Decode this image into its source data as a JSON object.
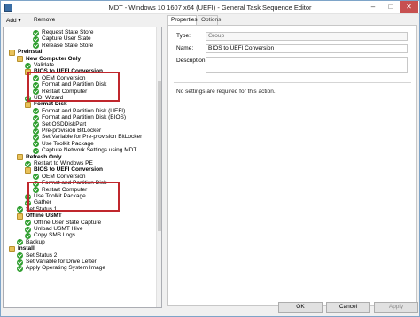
{
  "window": {
    "title": "MDT - Windows 10 1607 x64 (UEFI) - General Task Sequence Editor",
    "controls": {
      "minimize": "–",
      "maximize": "□",
      "close": "✕"
    }
  },
  "toolbar": {
    "add_label": "Add",
    "remove_label": "Remove"
  },
  "tree": [
    {
      "label": "Request State Store",
      "icon": "check",
      "indent": 3,
      "bold": false
    },
    {
      "label": "Capture User State",
      "icon": "check",
      "indent": 3,
      "bold": false
    },
    {
      "label": "Release State Store",
      "icon": "check",
      "indent": 3,
      "bold": false
    },
    {
      "label": "Preinstall",
      "icon": "folder",
      "indent": 0,
      "bold": true
    },
    {
      "label": "New Computer Only",
      "icon": "folder",
      "indent": 1,
      "bold": true
    },
    {
      "label": "Validate",
      "icon": "check",
      "indent": 2,
      "bold": false
    },
    {
      "label": "BIOS to UEFI Conversion",
      "icon": "folder",
      "indent": 2,
      "bold": true
    },
    {
      "label": "OEM Conversion",
      "icon": "check",
      "indent": 3,
      "bold": false
    },
    {
      "label": "Format and Partition Disk",
      "icon": "check",
      "indent": 3,
      "bold": false
    },
    {
      "label": "Restart Computer",
      "icon": "check",
      "indent": 3,
      "bold": false
    },
    {
      "label": "UDI Wizard",
      "icon": "check",
      "indent": 2,
      "bold": false
    },
    {
      "label": "Format Disk",
      "icon": "folder",
      "indent": 2,
      "bold": true
    },
    {
      "label": "Format and Partition Disk (UEFI)",
      "icon": "check",
      "indent": 3,
      "bold": false
    },
    {
      "label": "Format and Partition Disk (BIOS)",
      "icon": "check",
      "indent": 3,
      "bold": false
    },
    {
      "label": "Set OSDDiskPart",
      "icon": "check",
      "indent": 3,
      "bold": false
    },
    {
      "label": "Pre-provision BitLocker",
      "icon": "check",
      "indent": 3,
      "bold": false
    },
    {
      "label": "Set Variable for Pre-provision BitLocker",
      "icon": "check",
      "indent": 3,
      "bold": false
    },
    {
      "label": "Use Toolkit Package",
      "icon": "check",
      "indent": 3,
      "bold": false
    },
    {
      "label": "Capture Network Settings using MDT",
      "icon": "check",
      "indent": 3,
      "bold": false
    },
    {
      "label": "Refresh Only",
      "icon": "folder",
      "indent": 1,
      "bold": true
    },
    {
      "label": "Restart to Windows PE",
      "icon": "check",
      "indent": 2,
      "bold": false
    },
    {
      "label": "BIOS to UEFI Conversion",
      "icon": "folder",
      "indent": 2,
      "bold": true
    },
    {
      "label": "OEM Conversion",
      "icon": "check",
      "indent": 3,
      "bold": false
    },
    {
      "label": "Format and Partition Disk",
      "icon": "check",
      "indent": 3,
      "bold": false
    },
    {
      "label": "Restart Computer",
      "icon": "check",
      "indent": 3,
      "bold": false
    },
    {
      "label": "Use Toolkit Package",
      "icon": "check",
      "indent": 2,
      "bold": false
    },
    {
      "label": "Gather",
      "icon": "check",
      "indent": 2,
      "bold": false
    },
    {
      "label": "Set Status 1",
      "icon": "check",
      "indent": 1,
      "bold": false
    },
    {
      "label": "Offline USMT",
      "icon": "folder",
      "indent": 1,
      "bold": true
    },
    {
      "label": "Offline User State Capture",
      "icon": "check",
      "indent": 2,
      "bold": false
    },
    {
      "label": "Unload USMT Hive",
      "icon": "check",
      "indent": 2,
      "bold": false
    },
    {
      "label": "Copy SMS Logs",
      "icon": "check",
      "indent": 2,
      "bold": false
    },
    {
      "label": "Backup",
      "icon": "check",
      "indent": 1,
      "bold": false
    },
    {
      "label": "Install",
      "icon": "folder",
      "indent": 0,
      "bold": true
    },
    {
      "label": "Set Status 2",
      "icon": "check",
      "indent": 1,
      "bold": false
    },
    {
      "label": "Set Variable for Drive Letter",
      "icon": "check",
      "indent": 1,
      "bold": false
    },
    {
      "label": "Apply Operating System Image",
      "icon": "check",
      "indent": 1,
      "bold": false
    }
  ],
  "properties": {
    "tabs": [
      "Properties",
      "Options"
    ],
    "type_label": "Type:",
    "type_value": "Group",
    "name_label": "Name:",
    "name_value": "BIOS to UEFI Conversion",
    "description_label": "Description:",
    "description_value": "",
    "note": "No settings are required  for this action."
  },
  "buttons": {
    "ok": "OK",
    "cancel": "Cancel",
    "apply": "Apply"
  },
  "colors": {
    "highlight_box": "#c0272d",
    "check_icon": "#2f9e2f",
    "folder_icon": "#e8c15a"
  }
}
